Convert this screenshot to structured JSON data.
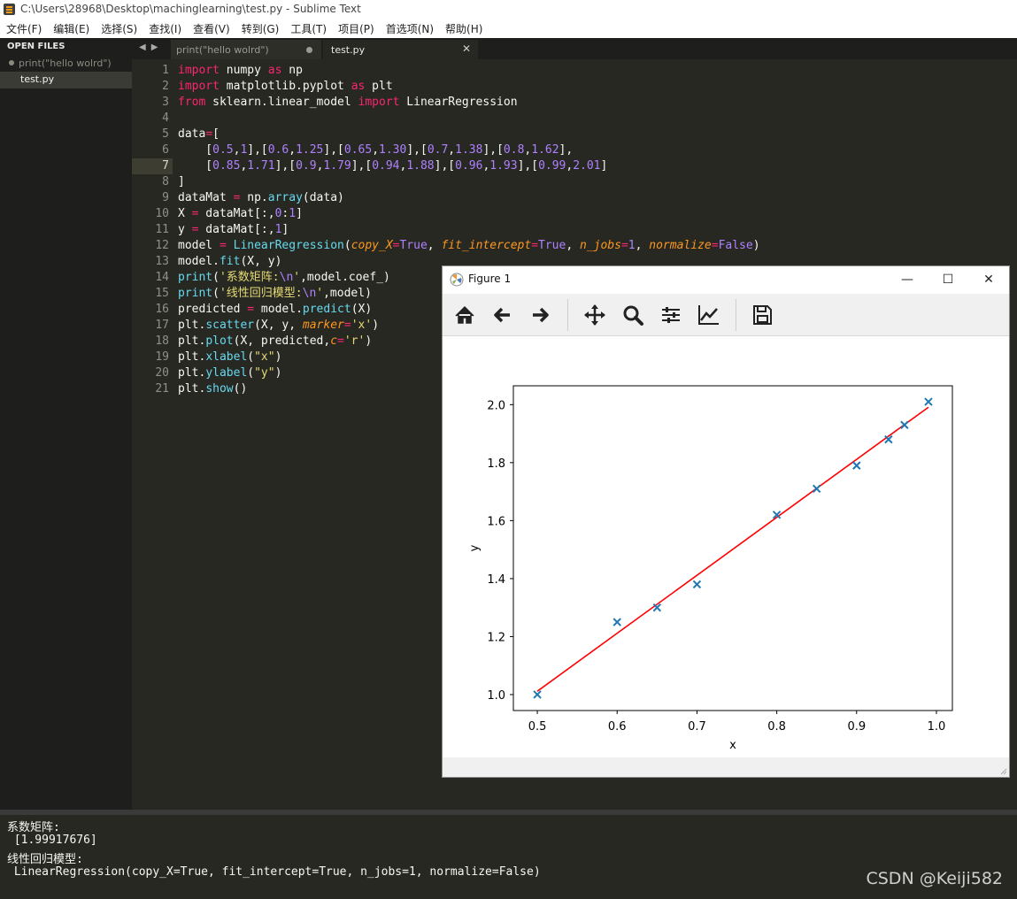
{
  "window": {
    "title": "C:\\Users\\28968\\Desktop\\machinglearning\\test.py - Sublime Text"
  },
  "menu": [
    "文件(F)",
    "编辑(E)",
    "选择(S)",
    "查找(I)",
    "查看(V)",
    "转到(G)",
    "工具(T)",
    "项目(P)",
    "首选项(N)",
    "帮助(H)"
  ],
  "sidebar": {
    "header": "OPEN FILES",
    "files": [
      "print(\"hello wolrd\")",
      "test.py"
    ]
  },
  "tabs": [
    {
      "label": "print(\"hello wolrd\")"
    },
    {
      "label": "test.py"
    }
  ],
  "editor": {
    "current_line": 7,
    "line_numbers": [
      "1",
      "2",
      "3",
      "4",
      "5",
      "6",
      "7",
      "8",
      "9",
      "10",
      "11",
      "12",
      "13",
      "14",
      "15",
      "16",
      "17",
      "18",
      "19",
      "20",
      "21"
    ]
  },
  "console": {
    "lines": [
      "系数矩阵:",
      " [1.99917676]",
      "线性回归模型:",
      " LinearRegression(copy_X=True, fit_intercept=True, n_jobs=1, normalize=False)"
    ]
  },
  "watermark": "CSDN @Keiji582",
  "figure": {
    "title": "Figure 1",
    "toolbar": [
      "home-icon",
      "back-icon",
      "forward-icon",
      "pan-icon",
      "zoom-icon",
      "configure-subplots-icon",
      "edit-axis-icon",
      "save-icon"
    ]
  },
  "chart_data": {
    "type": "scatter",
    "xlabel": "x",
    "ylabel": "y",
    "xlim": [
      0.47,
      1.02
    ],
    "ylim": [
      0.945,
      2.065
    ],
    "xticks": [
      "0.5",
      "0.6",
      "0.7",
      "0.8",
      "0.9",
      "1.0"
    ],
    "yticks": [
      "1.0",
      "1.2",
      "1.4",
      "1.6",
      "1.8",
      "2.0"
    ],
    "series": [
      {
        "marker": "x",
        "color": "#1f77b4",
        "x": [
          0.5,
          0.6,
          0.65,
          0.7,
          0.8,
          0.85,
          0.9,
          0.94,
          0.96,
          0.99
        ],
        "y": [
          1,
          1.25,
          1.3,
          1.38,
          1.62,
          1.71,
          1.79,
          1.88,
          1.93,
          2.01
        ]
      },
      {
        "type": "line",
        "color": "#ff0000",
        "x": [
          0.5,
          0.99
        ],
        "y": [
          1.0115,
          1.9911
        ]
      }
    ]
  }
}
